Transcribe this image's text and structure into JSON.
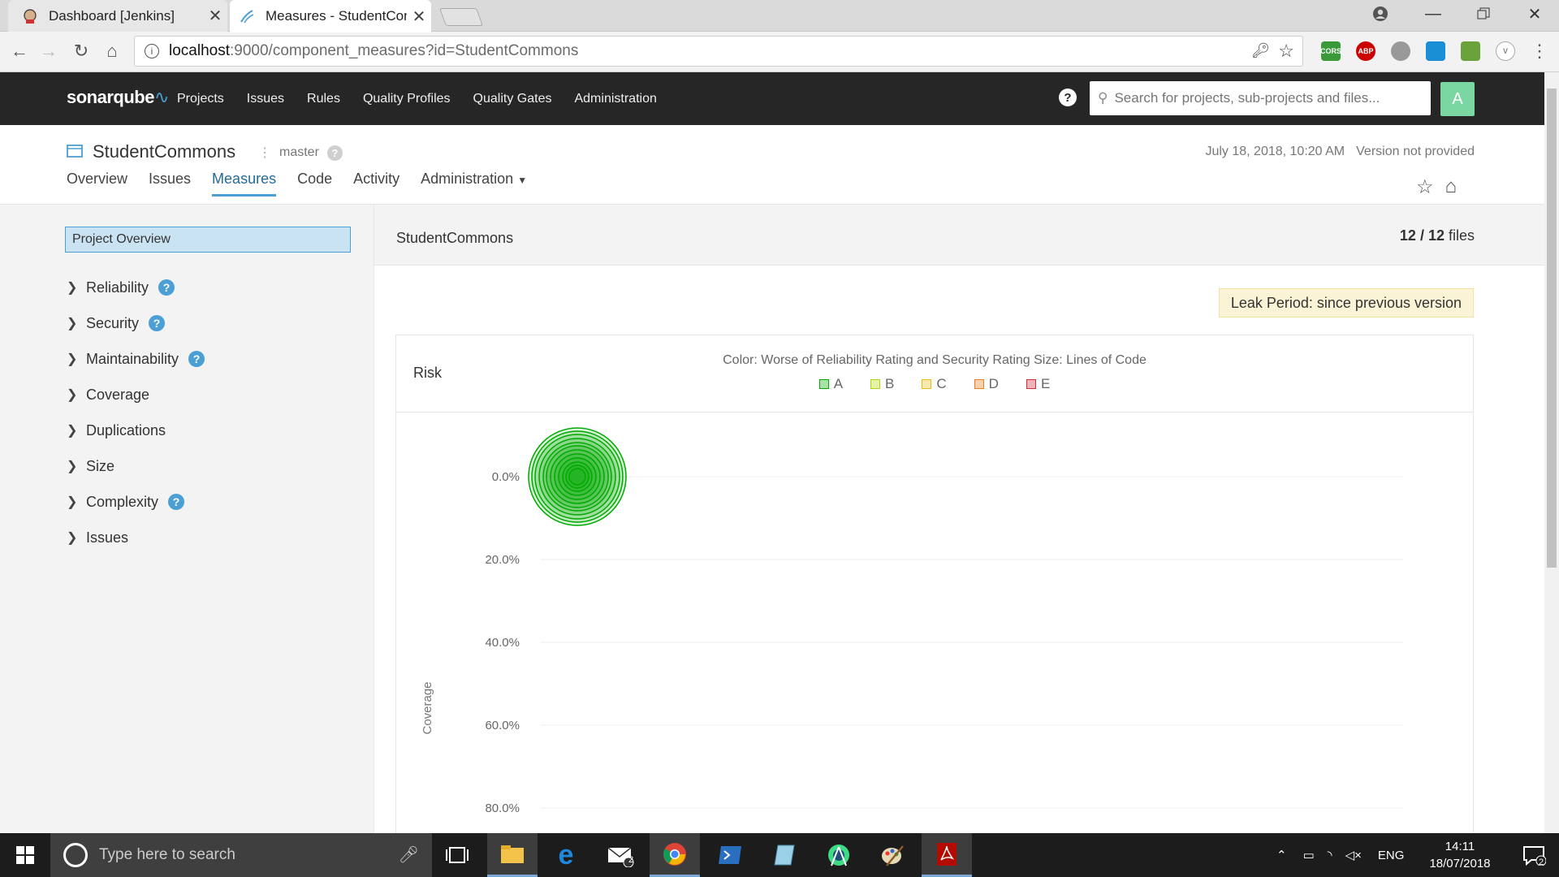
{
  "browser": {
    "tabs": [
      {
        "title": "Dashboard [Jenkins]",
        "active": false
      },
      {
        "title": "Measures - StudentComm",
        "active": true
      }
    ],
    "url_host": "localhost",
    "url_rest": ":9000/component_measures?id=StudentCommons",
    "extensions": [
      "CORS",
      "ABP"
    ]
  },
  "nav": {
    "logo": "sonarqube",
    "menu": [
      "Projects",
      "Issues",
      "Rules",
      "Quality Profiles",
      "Quality Gates",
      "Administration"
    ],
    "search_placeholder": "Search for projects, sub-projects and files...",
    "avatar": "A"
  },
  "project": {
    "name": "StudentCommons",
    "branch": "master",
    "date": "July 18, 2018, 10:20 AM",
    "version": "Version not provided",
    "tabs": [
      "Overview",
      "Issues",
      "Measures",
      "Code",
      "Activity",
      "Administration"
    ]
  },
  "sidebar": {
    "overview": "Project Overview",
    "domains": [
      {
        "label": "Reliability",
        "help": true
      },
      {
        "label": "Security",
        "help": true
      },
      {
        "label": "Maintainability",
        "help": true
      },
      {
        "label": "Coverage",
        "help": false
      },
      {
        "label": "Duplications",
        "help": false
      },
      {
        "label": "Size",
        "help": false
      },
      {
        "label": "Complexity",
        "help": true
      },
      {
        "label": "Issues",
        "help": false
      }
    ]
  },
  "main": {
    "component": "StudentCommons",
    "files": "12 / 12 files",
    "files_count": "12 / 12",
    "files_word": "files",
    "leak_period": "Leak Period: since previous version"
  },
  "chart_data": {
    "type": "scatter",
    "title": "Risk",
    "description": "Color: Worse of Reliability Rating and Security Rating   Size: Lines of Code",
    "legend": [
      {
        "label": "A",
        "color": "#0a0"
      },
      {
        "label": "B",
        "color": "#b0d513"
      },
      {
        "label": "C",
        "color": "#eabe06"
      },
      {
        "label": "D",
        "color": "#ed7d20"
      },
      {
        "label": "E",
        "color": "#d02f3a"
      }
    ],
    "ylabel": "Coverage",
    "yticks": [
      "0.0%",
      "20.0%",
      "40.0%",
      "60.0%",
      "80.0%"
    ],
    "ylim": [
      0,
      80
    ],
    "bubble_count": 12,
    "bubble_coverage": 0.0
  },
  "taskbar": {
    "search_placeholder": "Type here to search",
    "lang": "ENG",
    "time": "14:11",
    "date": "18/07/2018",
    "mail_badge": "2",
    "notif_badge": "2"
  }
}
